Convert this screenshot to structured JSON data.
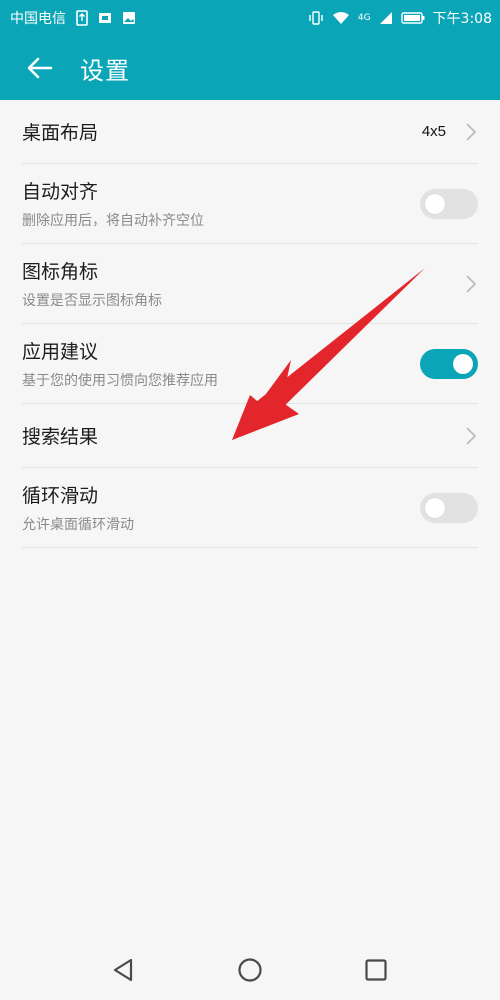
{
  "status_bar": {
    "carrier": "中国电信",
    "network": "4G",
    "time": "下午3:08",
    "icons": [
      "usb-icon",
      "sim-icon",
      "image-icon",
      "vibrate-icon",
      "wifi-icon",
      "signal-icon",
      "battery-icon"
    ]
  },
  "appbar": {
    "title": "设置"
  },
  "rows": [
    {
      "label": "桌面布局",
      "value": "4x5",
      "type": "chevron"
    },
    {
      "label": "自动对齐",
      "subtitle": "删除应用后，将自动补齐空位",
      "type": "toggle",
      "on": false
    },
    {
      "label": "图标角标",
      "subtitle": "设置是否显示图标角标",
      "type": "chevron"
    },
    {
      "label": "应用建议",
      "subtitle": "基于您的使用习惯向您推荐应用",
      "type": "toggle",
      "on": true
    },
    {
      "label": "搜索结果",
      "type": "chevron"
    },
    {
      "label": "循环滑动",
      "subtitle": "允许桌面循环滑动",
      "type": "toggle",
      "on": false
    }
  ],
  "colors": {
    "accent": "#0aa6b7",
    "annotation_arrow": "#e3262b"
  }
}
